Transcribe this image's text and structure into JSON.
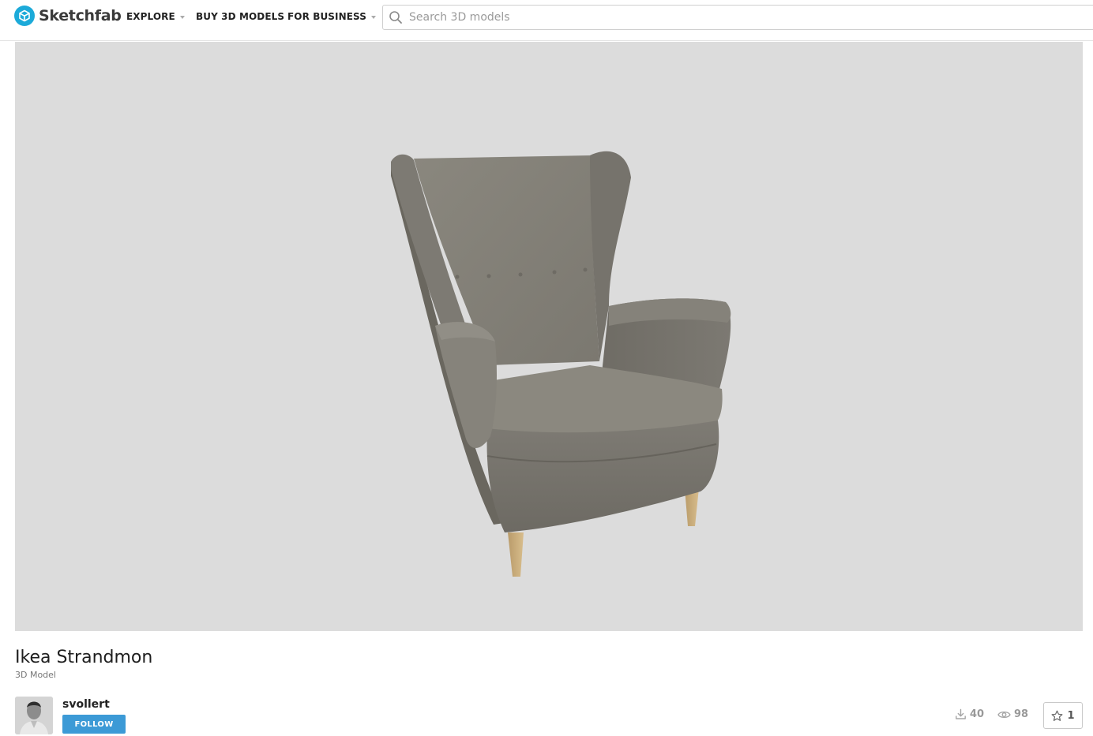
{
  "brand": {
    "name": "Sketchfab",
    "accent_color": "#1caad9"
  },
  "nav": {
    "items": [
      {
        "label": "EXPLORE",
        "has_dropdown": true
      },
      {
        "label": "BUY 3D MODELS",
        "has_dropdown": false
      },
      {
        "label": "FOR BUSINESS",
        "has_dropdown": true
      }
    ]
  },
  "search": {
    "placeholder": "Search 3D models",
    "value": ""
  },
  "viewer": {
    "background_color": "#dcdcdc",
    "subject_icon": "armchair-3d-model"
  },
  "model": {
    "title": "Ikea Strandmon",
    "type_label": "3D Model"
  },
  "author": {
    "name": "svollert",
    "follow_label": "FOLLOW",
    "follow_color": "#3c9ad6"
  },
  "stats": {
    "downloads": "40",
    "views": "98",
    "likes": "1"
  }
}
